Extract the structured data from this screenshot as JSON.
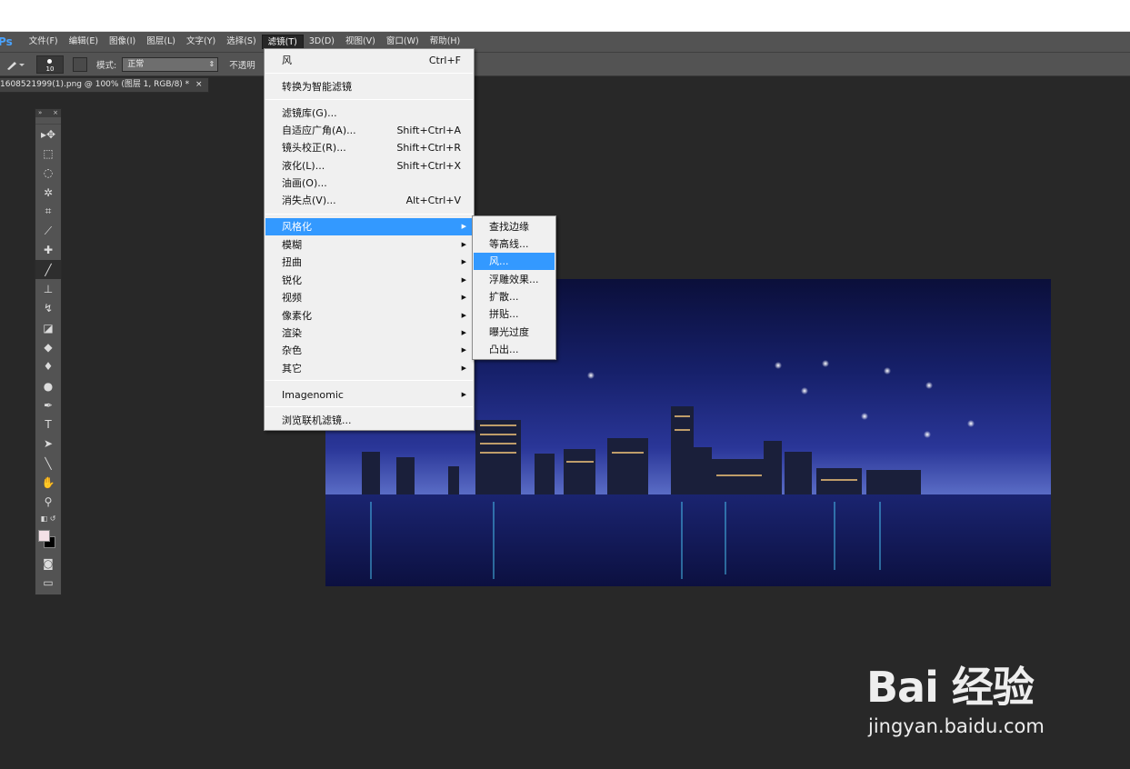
{
  "app": {
    "logo": "Ps"
  },
  "menubar": {
    "items": [
      "文件(F)",
      "编辑(E)",
      "图像(I)",
      "图层(L)",
      "文字(Y)",
      "选择(S)",
      "滤镜(T)",
      "3D(D)",
      "视图(V)",
      "窗口(W)",
      "帮助(H)"
    ]
  },
  "options": {
    "brush_size": "10",
    "mode_label": "模式:",
    "mode_value": "正常",
    "opacity_label": "不透明"
  },
  "document_tab": {
    "title": "1608521999(1).png @ 100% (图层 1, RGB/8) *",
    "close": "×"
  },
  "toolbox": {
    "header_left": "»",
    "header_right": "×"
  },
  "filter_menu": {
    "last_filter": {
      "label": "风",
      "shortcut": "Ctrl+F"
    },
    "convert_smart": "转换为智能滤镜",
    "gallery": "滤镜库(G)...",
    "adaptive_wide": {
      "label": "自适应广角(A)...",
      "shortcut": "Shift+Ctrl+A"
    },
    "lens_correction": {
      "label": "镜头校正(R)...",
      "shortcut": "Shift+Ctrl+R"
    },
    "liquify": {
      "label": "液化(L)...",
      "shortcut": "Shift+Ctrl+X"
    },
    "oil_paint": "油画(O)...",
    "vanishing_point": {
      "label": "消失点(V)...",
      "shortcut": "Alt+Ctrl+V"
    },
    "groups": [
      "风格化",
      "模糊",
      "扭曲",
      "锐化",
      "视频",
      "像素化",
      "渲染",
      "杂色",
      "其它"
    ],
    "imagenomic": "Imagenomic",
    "browse_online": "浏览联机滤镜..."
  },
  "stylize_submenu": {
    "items": [
      "查找边缘",
      "等高线...",
      "风...",
      "浮雕效果...",
      "扩散...",
      "拼贴...",
      "曝光过度",
      "凸出..."
    ],
    "highlighted_index": 2
  },
  "watermark": {
    "logo": "Bai 经验",
    "site": "jingyan.baidu.com"
  },
  "colors": {
    "foreground": "#f3e1e6",
    "background": "#000000",
    "highlight": "#3399ff"
  }
}
